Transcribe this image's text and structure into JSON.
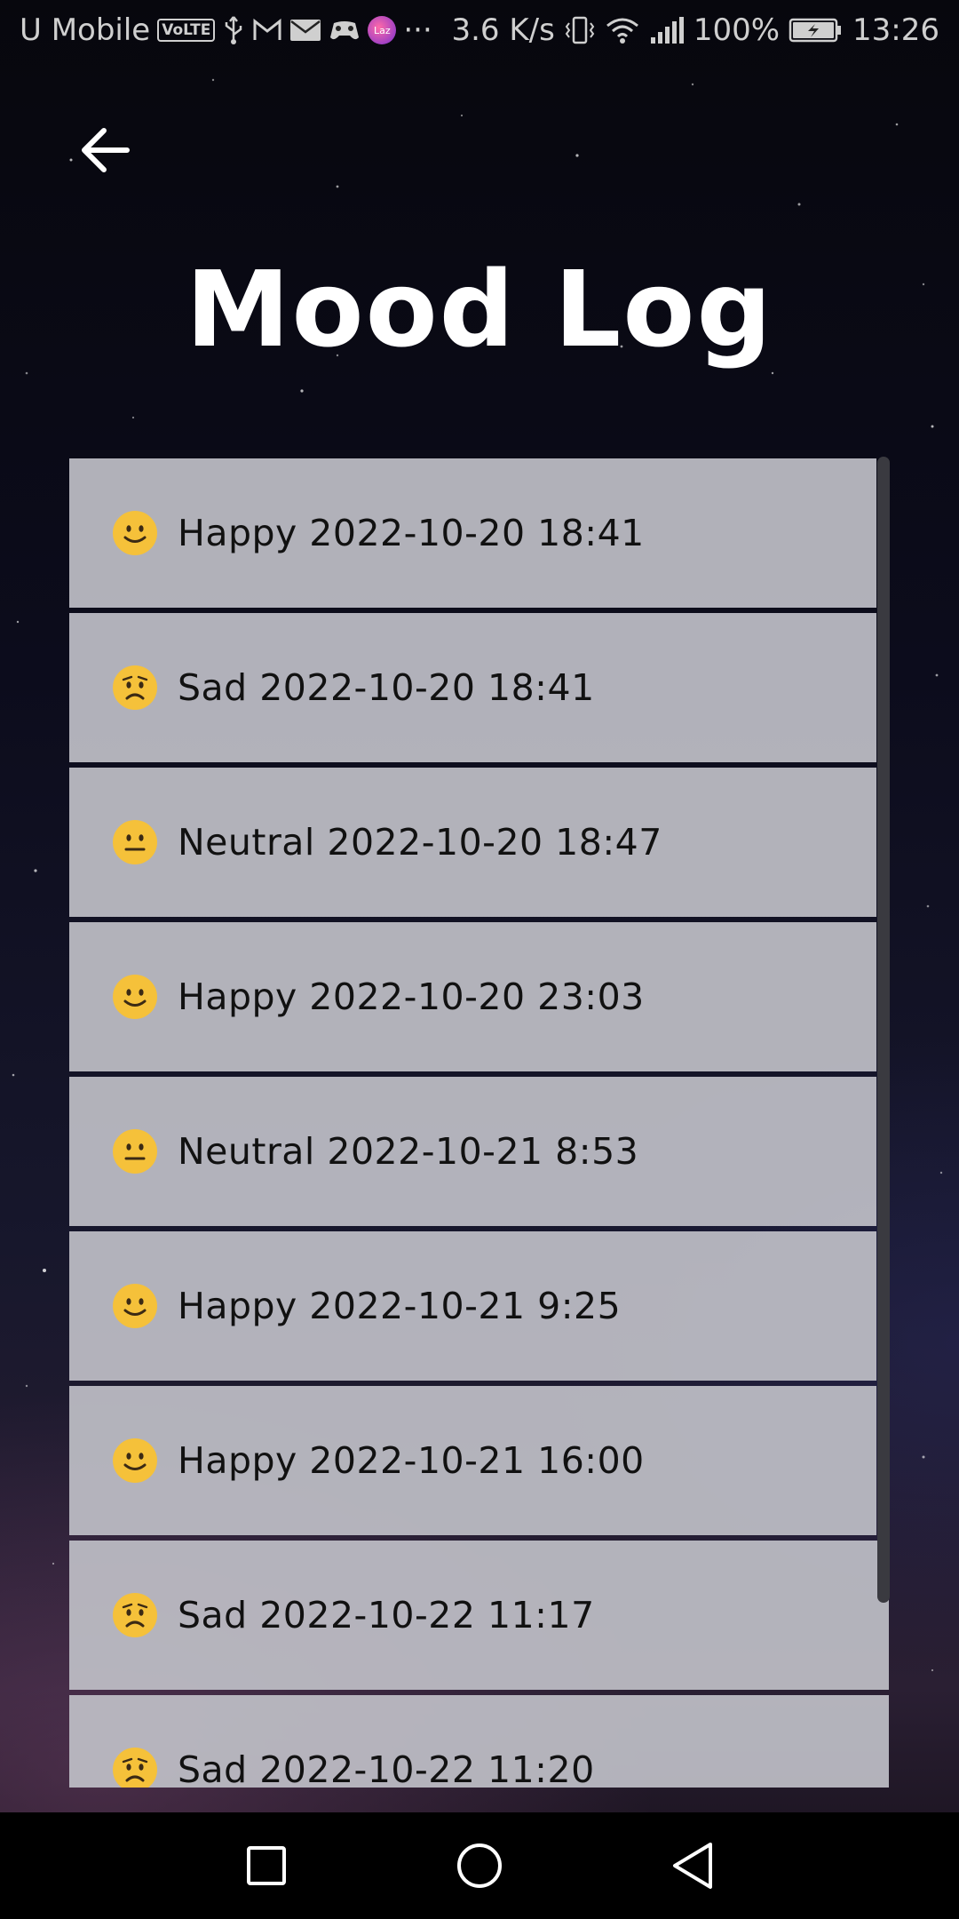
{
  "status_bar": {
    "carrier": "U Mobile",
    "volte": "VoLTE",
    "more": "···",
    "net_speed": "3.6 K/s",
    "battery": "100%",
    "time": "13:26",
    "laz": "Laz"
  },
  "header": {
    "title": "Mood Log"
  },
  "mood_entries": [
    {
      "mood": "happy",
      "text": "Happy 2022-10-20 18:41"
    },
    {
      "mood": "sad",
      "text": "Sad 2022-10-20 18:41"
    },
    {
      "mood": "neutral",
      "text": "Neutral 2022-10-20 18:47"
    },
    {
      "mood": "happy",
      "text": "Happy 2022-10-20 23:03"
    },
    {
      "mood": "neutral",
      "text": "Neutral 2022-10-21 8:53"
    },
    {
      "mood": "happy",
      "text": "Happy 2022-10-21 9:25"
    },
    {
      "mood": "happy",
      "text": "Happy 2022-10-21 16:00"
    },
    {
      "mood": "sad",
      "text": "Sad 2022-10-22 11:17"
    },
    {
      "mood": "sad",
      "text": "Sad 2022-10-22 11:20"
    }
  ],
  "icons": {
    "back": "arrow-left-icon",
    "nav": [
      "square-icon",
      "circle-icon",
      "triangle-back-icon"
    ]
  },
  "colors": {
    "list_item_bg": "#bebec6",
    "emoji_yellow": "#f5c13a"
  }
}
